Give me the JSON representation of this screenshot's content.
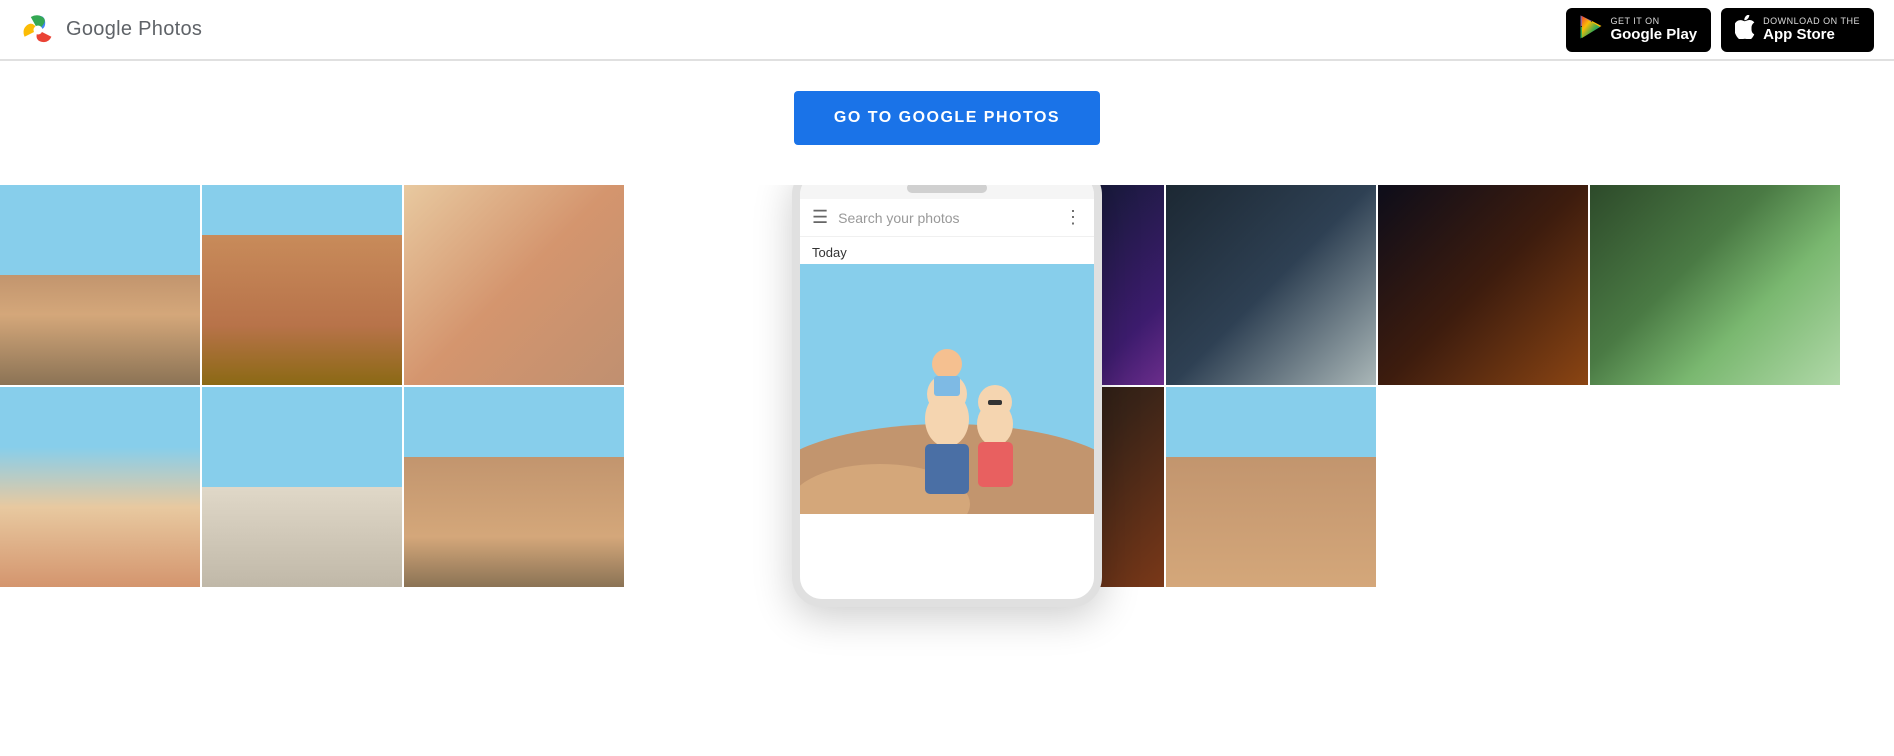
{
  "header": {
    "logo_text": "Google Photos",
    "google_play": {
      "pre_label": "GET IT ON",
      "main_label": "Google Play",
      "icon": "▶"
    },
    "app_store": {
      "pre_label": "Download on the",
      "main_label": "App Store",
      "icon": ""
    }
  },
  "hero": {
    "cta_label": "GO TO GOOGLE PHOTOS"
  },
  "phone_mockup": {
    "search_placeholder": "Search your photos",
    "today_label": "Today"
  },
  "photos": {
    "left": [
      {
        "id": "desert-walk",
        "css_class": "photo-fill-1"
      },
      {
        "id": "red-rocks",
        "css_class": "photo-fill-2"
      },
      {
        "id": "boy-selfie",
        "css_class": "photo-fill-3"
      },
      {
        "id": "couple-selfie",
        "css_class": "photo-fill-4"
      },
      {
        "id": "telescope",
        "css_class": "photo-fill-5"
      },
      {
        "id": "sitting-rocks",
        "css_class": "photo-fill-6"
      }
    ],
    "right": [
      {
        "id": "campfire",
        "css_class": "photo-fill-7"
      },
      {
        "id": "man-sitting",
        "css_class": "photo-fill-8"
      },
      {
        "id": "family-fire",
        "css_class": "photo-fill-9"
      },
      {
        "id": "tent",
        "css_class": "photo-fill-10"
      },
      {
        "id": "pan-food",
        "css_class": "photo-fill-11"
      },
      {
        "id": "man-truck",
        "css_class": "photo-fill-12"
      }
    ]
  }
}
